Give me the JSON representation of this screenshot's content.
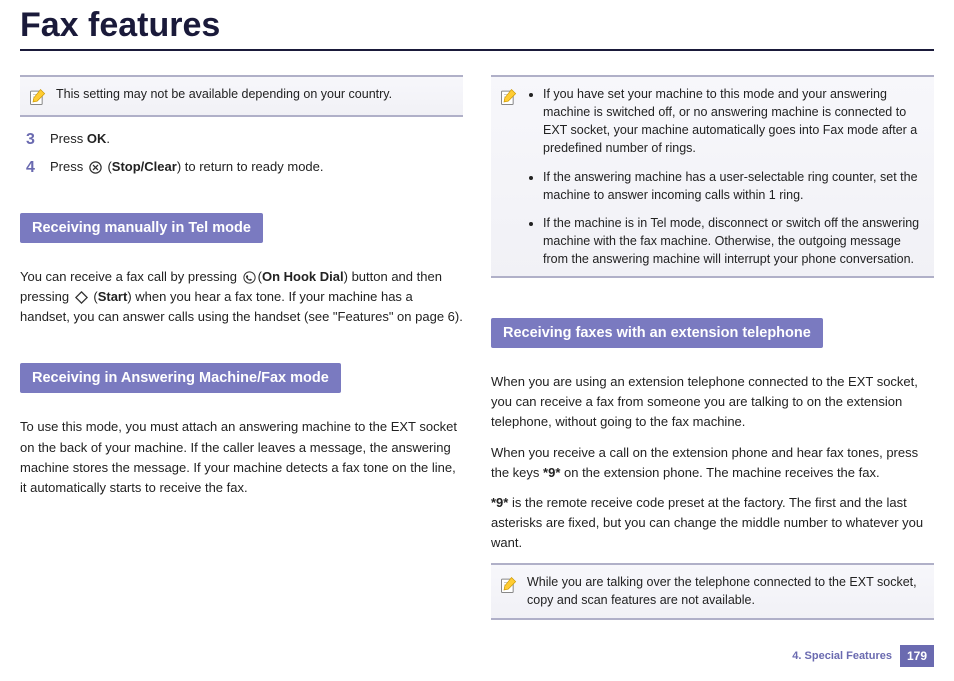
{
  "title": "Fax features",
  "left": {
    "note1": "This setting may not be available depending on your country.",
    "step3_num": "3",
    "step3_a": "Press ",
    "step3_b": "OK",
    "step3_c": ".",
    "step4_num": "4",
    "step4_a": "Press ",
    "step4_b": "Stop/Clear",
    "step4_c": ") to return to ready mode.",
    "sec1": "Receiving manually in Tel mode",
    "p1_a": "You can receive a fax call by pressing ",
    "p1_b": "On Hook Dial",
    "p1_c": ") button and then pressing ",
    "p1_d": "Start",
    "p1_e": ") when you hear a fax tone. If your machine has a handset, you can answer calls using the handset (see \"Features\" on page 6).",
    "sec2": "Receiving in Answering Machine/Fax mode",
    "p2": "To use this mode, you must attach an answering machine to the EXT socket on the back of your machine. If the caller leaves a message, the answering machine stores the message. If your machine detects a fax tone on the line, it automatically starts to receive the fax."
  },
  "right": {
    "note_li1": "If you have set your machine to this mode and your answering machine is switched off, or no answering machine is connected to EXT socket, your machine automatically goes into Fax mode after a predefined number of rings.",
    "note_li2": "If the answering machine has a user-selectable ring counter, set the machine to answer incoming calls within 1 ring.",
    "note_li3": "If the machine is in Tel mode, disconnect or switch off the answering machine with the fax machine. Otherwise, the outgoing message from the answering machine will interrupt your phone conversation.",
    "sec3": "Receiving faxes with an extension telephone",
    "p3": "When you are using an extension telephone connected to the EXT socket, you can receive a fax from someone you are talking to on the extension telephone, without going to the fax machine.",
    "p4_a": "When you receive a call on the extension phone and hear fax tones, press the keys ",
    "p4_b": "*9*",
    "p4_c": " on the extension phone. The machine receives the fax.",
    "p5_a": "*9*",
    "p5_b": " is the remote receive code preset at the factory. The first and the last asterisks are fixed, but you can change the middle number to whatever you want.",
    "note2": "While you are talking over the telephone connected to the EXT socket, copy and scan features are not available."
  },
  "footer": {
    "chapter": "4.  Special Features",
    "page": "179"
  }
}
